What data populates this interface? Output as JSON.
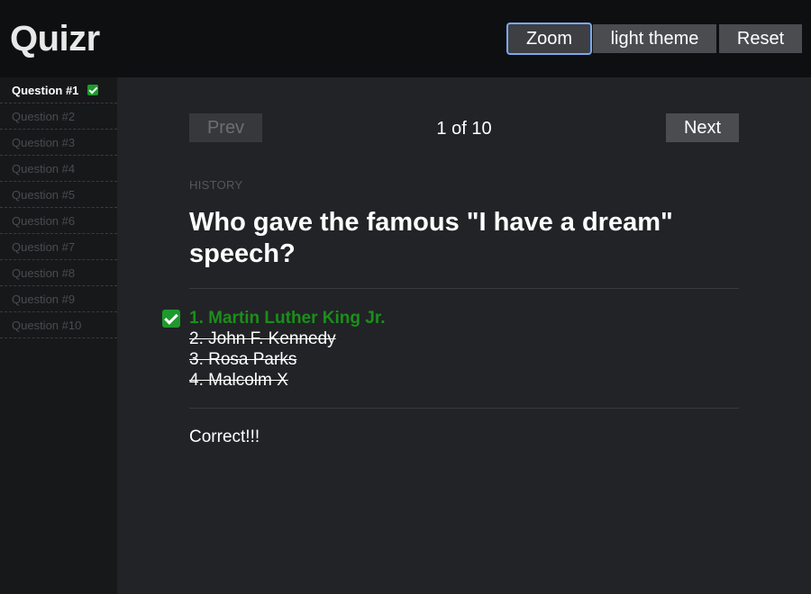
{
  "app": {
    "title": "Quizr"
  },
  "header": {
    "zoom_label": "Zoom",
    "theme_label": "light theme",
    "reset_label": "Reset"
  },
  "sidebar": {
    "items": [
      {
        "label": "Question #1",
        "status": "answered-correct"
      },
      {
        "label": "Question #2"
      },
      {
        "label": "Question #3"
      },
      {
        "label": "Question #4"
      },
      {
        "label": "Question #5"
      },
      {
        "label": "Question #6"
      },
      {
        "label": "Question #7"
      },
      {
        "label": "Question #8"
      },
      {
        "label": "Question #9"
      },
      {
        "label": "Question #10"
      }
    ]
  },
  "nav": {
    "prev_label": "Prev",
    "next_label": "Next",
    "counter": "1 of 10"
  },
  "question": {
    "category": "HISTORY",
    "text": "Who gave the famous \"I have a dream\" speech?",
    "answers": [
      {
        "label": "1. Martin Luther King Jr.",
        "state": "correct"
      },
      {
        "label": "2. John F. Kennedy",
        "state": "eliminated"
      },
      {
        "label": "3. Rosa Parks",
        "state": "eliminated"
      },
      {
        "label": "4. Malcolm X",
        "state": "eliminated"
      }
    ],
    "feedback": "Correct!!!"
  },
  "colors": {
    "correct": "#1a8f1a",
    "check_badge": "#1d9a2c",
    "focus_ring": "#7aa9f0"
  }
}
